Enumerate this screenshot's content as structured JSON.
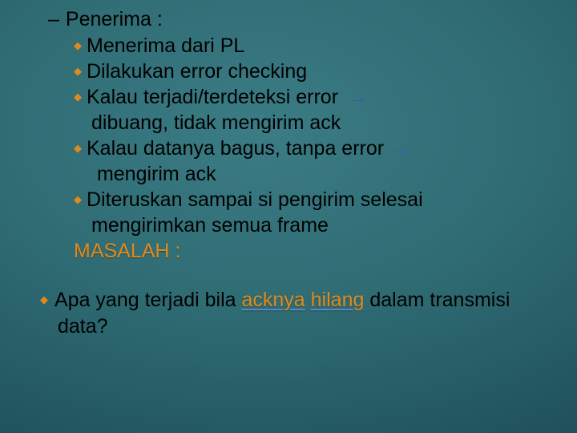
{
  "header": {
    "label": "Penerima :"
  },
  "bullets": {
    "b1": "Menerima dari PL",
    "b2": "Dilakukan error checking",
    "b3a": "Kalau terjadi/terdeteksi error",
    "b3b": "dibuang, tidak mengirim ack",
    "b4a": "Kalau datanya bagus, tanpa error",
    "b4b": "mengirim ack",
    "b5a": "Diteruskan sampai si pengirim selesai",
    "b5b": "mengirimkan semua frame"
  },
  "arrow_glyph": "→",
  "masalah": "MASALAH :",
  "question": {
    "pre": "Apa yang terjadi bila ",
    "hl1": "acknya",
    "hl2": "hilang",
    "post": " dalam transmisi data?"
  }
}
